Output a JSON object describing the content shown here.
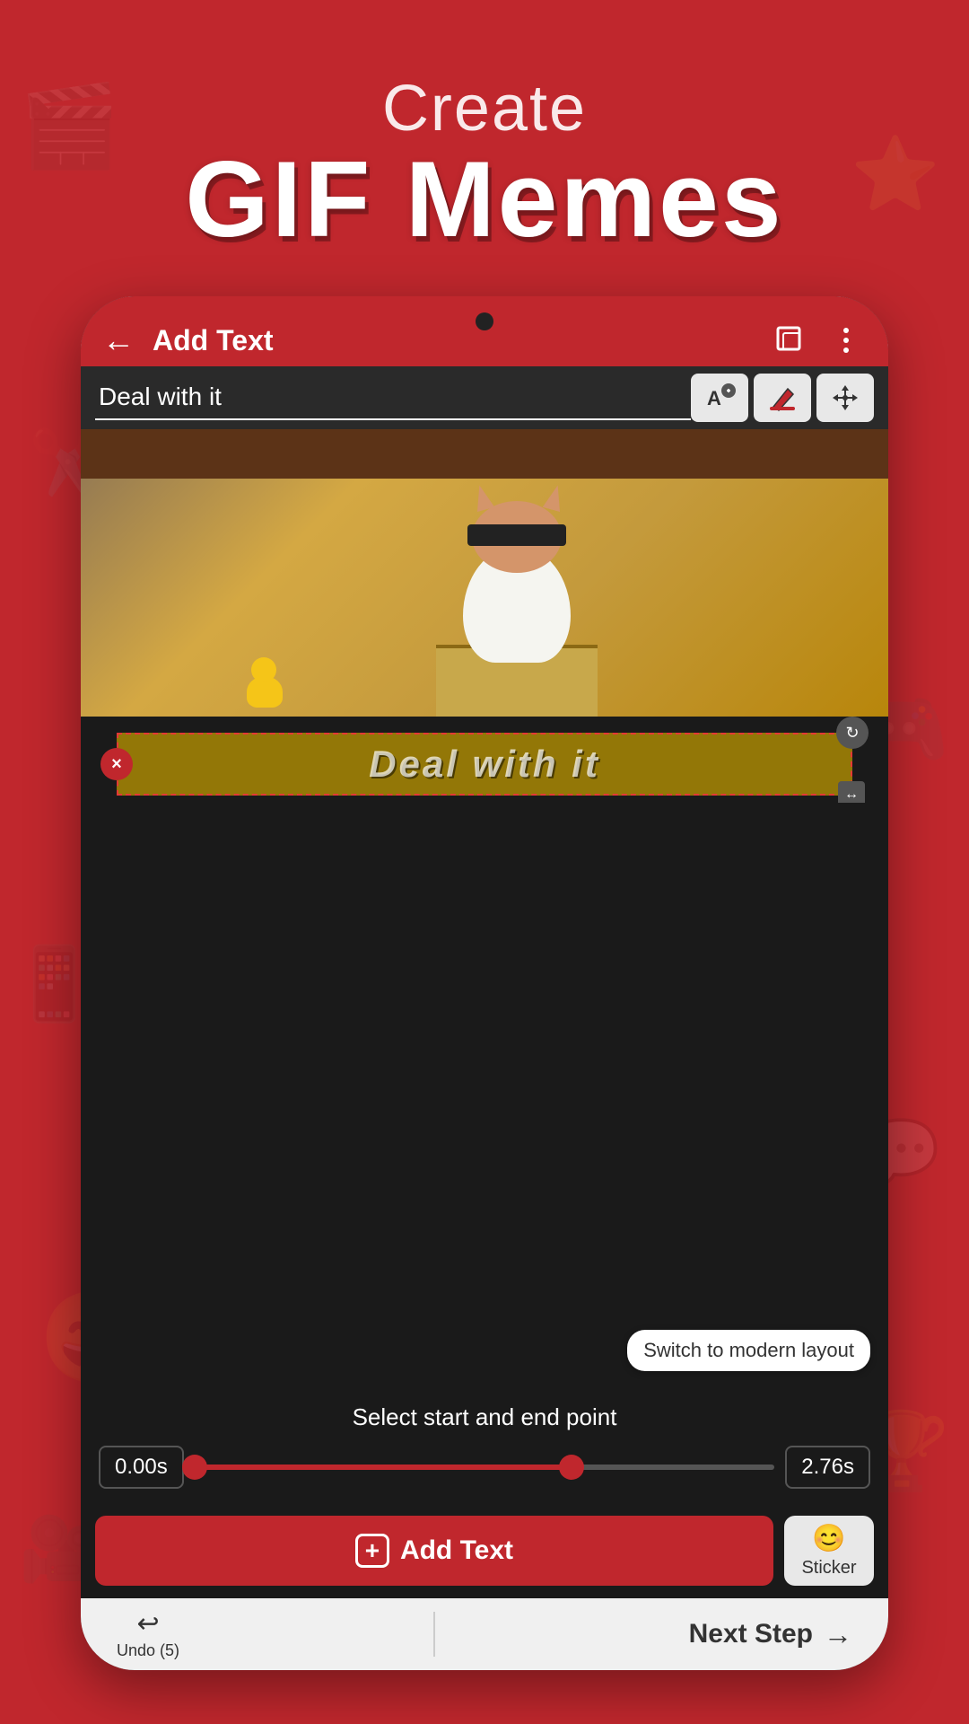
{
  "header": {
    "create_label": "Create",
    "gif_memes_label": "GIF Memes"
  },
  "top_bar": {
    "back_label": "←",
    "title": "Add Text",
    "square_icon": "square-frame",
    "more_icon": "more-vertical"
  },
  "text_input": {
    "value": "Deal with it",
    "placeholder": "Deal with it",
    "tool_a_label": "A",
    "tool_fill_label": "fill",
    "tool_move_label": "move"
  },
  "gif_overlay": {
    "text_content": "Deal with it",
    "close_handle": "×",
    "rotate_handle": "↻",
    "resize_handle": "↔"
  },
  "timeline": {
    "select_label": "Select start and end point",
    "start_time": "0.00s",
    "end_time": "2.76s",
    "fill_percent": 65
  },
  "actions": {
    "add_text_label": "Add Text",
    "sticker_label": "Sticker"
  },
  "bottom_nav": {
    "undo_icon": "↩",
    "undo_label": "Undo (5)",
    "next_step_label": "Next Step",
    "next_arrow": "→"
  },
  "layout_switch": {
    "label": "Switch to modern layout"
  }
}
